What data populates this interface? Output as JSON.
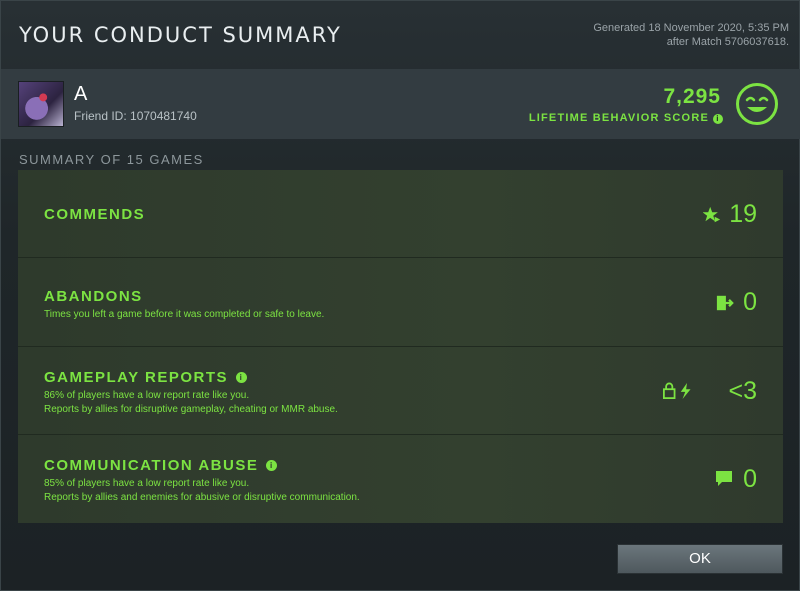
{
  "dialog": {
    "title": "YOUR CONDUCT SUMMARY",
    "generated_line1": "Generated 18 November 2020, 5:35 PM",
    "generated_line2": "after Match 5706037618."
  },
  "player": {
    "name": "A",
    "friend_id": "Friend ID: 1070481740",
    "avatar_icon": "hero-portrait"
  },
  "score": {
    "value": "7,295",
    "label": "LIFETIME BEHAVIOR SCORE",
    "info_icon": "info-icon",
    "face_icon": "smiley-face-icon",
    "accent": "#7ce342"
  },
  "summary": {
    "label": "SUMMARY OF 15 GAMES",
    "rows": [
      {
        "title": "COMMENDS",
        "sub1": "",
        "sub2": "",
        "value": "19",
        "icon": "star-commend-icon"
      },
      {
        "title": "ABANDONS",
        "sub1": "Times you left a game before it was completed or safe to leave.",
        "sub2": "",
        "value": "0",
        "icon": "exit-door-icon"
      },
      {
        "title": "GAMEPLAY REPORTS",
        "sub1": "86% of players have a low report rate like you.",
        "sub2": "Reports by allies for disruptive gameplay, cheating or MMR abuse.",
        "value": "<3",
        "icon": "lock-lightning-icon"
      },
      {
        "title": "COMMUNICATION ABUSE",
        "sub1": "85% of players have a low report rate like you.",
        "sub2": "Reports by allies and enemies for abusive or disruptive communication.",
        "value": "0",
        "icon": "chat-bubble-icon"
      }
    ]
  },
  "buttons": {
    "ok": "OK"
  }
}
